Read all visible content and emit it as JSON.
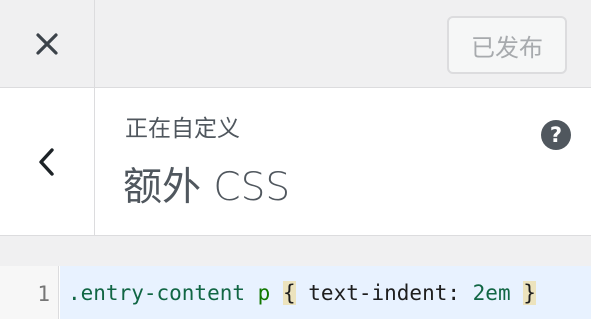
{
  "header": {
    "close_icon": "close-icon",
    "publish_label": "已发布"
  },
  "section": {
    "back_icon": "chevron-left-icon",
    "breadcrumb": "正在自定义",
    "title": "额外 CSS",
    "help_icon": "help-icon",
    "help_glyph": "?"
  },
  "editor": {
    "line_number": "1",
    "tokens": {
      "selector": ".entry-content",
      "space1": " ",
      "tag": "p",
      "space2": " ",
      "open_brace": "{",
      "declaration": " text-indent: ",
      "value": "2em",
      "space3": " ",
      "close_brace": "}"
    }
  },
  "colors": {
    "background": "#f0f0f1",
    "panel": "#ffffff",
    "text": "#50575e",
    "disabled_text": "#a7aaad",
    "active_line": "#e8f2ff",
    "matched_brace": "#ece3bd",
    "code_green": "#117700"
  }
}
